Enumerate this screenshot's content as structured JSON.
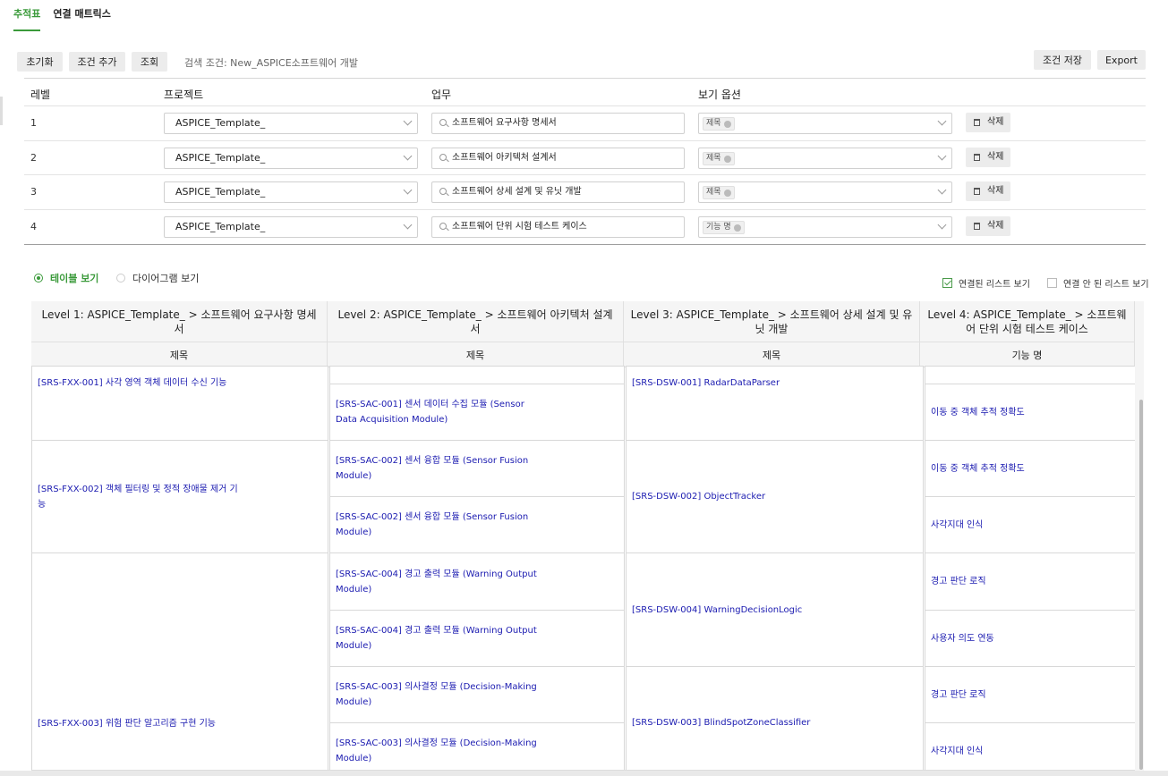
{
  "tabs": [
    {
      "label": "추적표",
      "active": true
    },
    {
      "label": "연결 매트릭스",
      "active": false
    }
  ],
  "toolbar": {
    "reset": "초기화",
    "add_condition": "조건 추가",
    "query": "조회",
    "condition_text": "검색 조건: New_ASPICE소프트웨어 개발",
    "save_condition": "조건 저장",
    "export": "Export"
  },
  "level_table": {
    "headers": {
      "level": "레벨",
      "project": "프로젝트",
      "task": "업무",
      "view_option": "보기 옵션"
    },
    "rows": [
      {
        "level": "1",
        "project": "ASPICE_Template_",
        "task": "소프트웨어 요구사항 명세서",
        "option": "제목",
        "delete": "삭제"
      },
      {
        "level": "2",
        "project": "ASPICE_Template_",
        "task": "소프트웨어 아키텍처 설계서",
        "option": "제목",
        "delete": "삭제"
      },
      {
        "level": "3",
        "project": "ASPICE_Template_",
        "task": "소프트웨어 상세 설계 및 유닛 개발",
        "option": "제목",
        "delete": "삭제"
      },
      {
        "level": "4",
        "project": "ASPICE_Template_",
        "task": "소프트웨어 단위 시험 테스트 케이스",
        "option": "기능 명",
        "delete": "삭제"
      }
    ]
  },
  "view": {
    "table_view": "테이블 보기",
    "diagram_view": "다이어그램 보기",
    "show_linked": "연결된 리스트 보기",
    "show_unlinked": "연결 안 된 리스트 보기"
  },
  "grid": {
    "headers": [
      "Level 1: ASPICE_Template_ > 소프트웨어 요구사항 명세서",
      "Level 2: ASPICE_Template_ > 소프트웨어 아키텍처 설계서",
      "Level 3: ASPICE_Template_ > 소프트웨어 상세 설계 및 유닛 개발",
      "Level 4: ASPICE_Template_ > 소프트웨어 단위 시험 테스트 케이스"
    ],
    "subheaders": [
      "제목",
      "제목",
      "제목",
      "기능 명"
    ],
    "l1": [
      "[SRS-FXX-001] 사각 영역 객체 데이터 수신 기능",
      "[SRS-FXX-002] 객체 필터링 및 정적 장애물 제거 기능",
      "[SRS-FXX-003] 위험 판단 알고리즘 구현 기능"
    ],
    "l2": [
      "[SRS-SAC-001] 센서 데이터 수집 모듈 (Sensor Data Acquisition Module)",
      "[SRS-SAC-002] 센서 융합 모듈 (Sensor Fusion Module)",
      "[SRS-SAC-002] 센서 융합 모듈 (Sensor Fusion Module)",
      "[SRS-SAC-004] 경고 출력 모듈 (Warning Output Module)",
      "[SRS-SAC-004] 경고 출력 모듈 (Warning Output Module)",
      "[SRS-SAC-003] 의사결정 모듈 (Decision-Making Module)",
      "[SRS-SAC-003] 의사결정 모듈 (Decision-Making Module)"
    ],
    "l3": [
      "[SRS-DSW-001] RadarDataParser",
      "[SRS-DSW-002] ObjectTracker",
      "[SRS-DSW-004] WarningDecisionLogic",
      "[SRS-DSW-003] BlindSpotZoneClassifier"
    ],
    "l4": [
      "이동 중 객체 추적 정확도",
      "이동 중 객체 추적 정확도",
      "사각지대 인식",
      "경고 판단 로직",
      "사용자 의도 연동",
      "경고 판단 로직",
      "사각지대 인식"
    ]
  }
}
